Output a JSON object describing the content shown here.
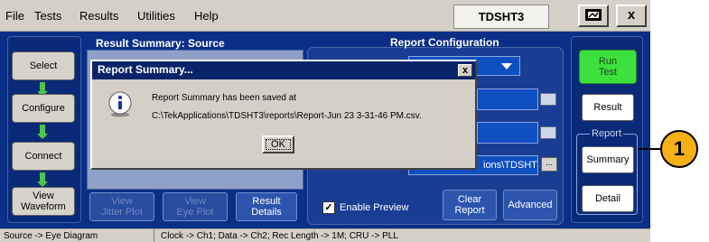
{
  "menubar": {
    "items": [
      "File",
      "Tests",
      "Results",
      "Utilities",
      "Help"
    ],
    "app_title": "TDSHT3",
    "monitor_icon": "monitor-icon",
    "close_label": "x"
  },
  "left_nav": {
    "items": [
      {
        "label": "Select"
      },
      {
        "label": "Configure"
      },
      {
        "label": "Connect"
      },
      {
        "label_line1": "View",
        "label_line2": "Waveform"
      }
    ]
  },
  "result_panel": {
    "title": "Result Summary: Source",
    "buttons": [
      {
        "line1": "View",
        "line2": "Jitter Plot",
        "enabled": false
      },
      {
        "line1": "View",
        "line2": "Eye Plot",
        "enabled": false
      },
      {
        "line1": "Result",
        "line2": "Details",
        "enabled": true
      }
    ]
  },
  "config_panel": {
    "title": "Report Configuration",
    "path_text": "ions\\TDSHT",
    "browse_label": "...",
    "enable_preview_label": "Enable Preview",
    "enable_preview_checked": true,
    "clear_report_line1": "Clear",
    "clear_report_line2": "Report",
    "advanced_label": "Advanced"
  },
  "right_nav": {
    "run_line1": "Run",
    "run_line2": "Test",
    "result_label": "Result",
    "report_group_label": "Report",
    "summary_label": "Summary",
    "detail_label": "Detail"
  },
  "dialog": {
    "title": "Report Summary...",
    "message_line1": "Report Summary has been saved at",
    "message_line2": "C:\\TekApplications\\TDSHT3\\reports\\Report-Jun 23 3-31-46 PM.csv.",
    "ok_label": "OK",
    "close_label": "x"
  },
  "statusbar": {
    "left": "Source -> Eye Diagram",
    "right": "Clock -> Ch1; Data -> Ch2; Rec Length -> 1M; CRU -> PLL"
  },
  "callout": {
    "number": "1"
  },
  "colors": {
    "panel_blue": "#0b2f86",
    "run_green": "#3ee03e",
    "callout_orange": "#f5b018",
    "dialog_title": "#0a246a"
  }
}
